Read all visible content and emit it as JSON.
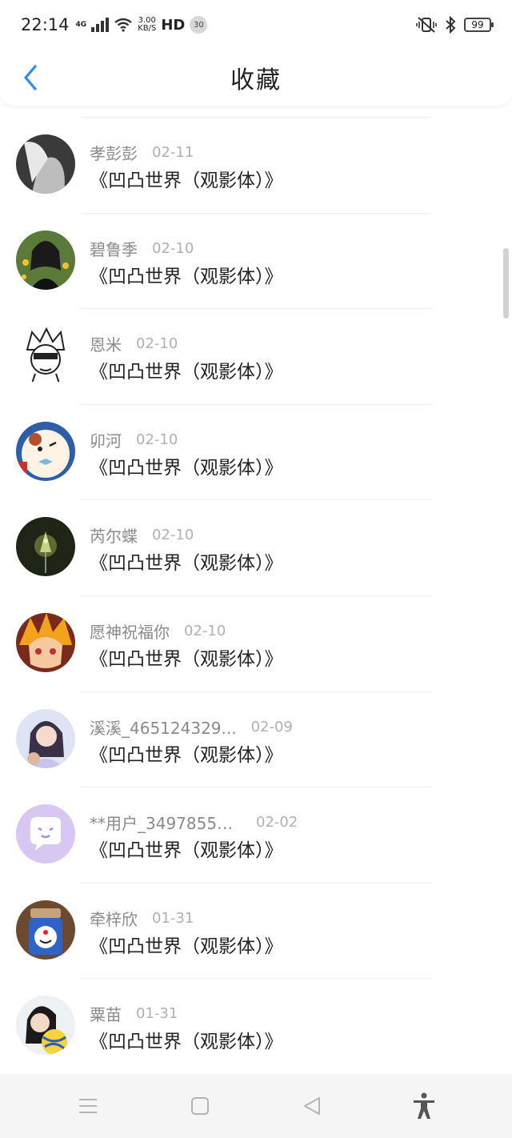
{
  "status": {
    "time": "22:14",
    "network": "4G",
    "speed_value": "3.00",
    "speed_unit": "KB/S",
    "hd": "HD",
    "badge": "30",
    "battery": "99"
  },
  "header": {
    "title": "收藏"
  },
  "items": [
    {
      "name": "孝彭彭",
      "date": "02-11",
      "title": "《凹凸世界（观影体）》"
    },
    {
      "name": "碧鲁季",
      "date": "02-10",
      "title": "《凹凸世界（观影体）》"
    },
    {
      "name": "恩米",
      "date": "02-10",
      "title": "《凹凸世界（观影体）》"
    },
    {
      "name": "卯河",
      "date": "02-10",
      "title": "《凹凸世界（观影体）》"
    },
    {
      "name": "芮尔蝶",
      "date": "02-10",
      "title": "《凹凸世界（观影体）》"
    },
    {
      "name": "愿神祝福你",
      "date": "02-10",
      "title": "《凹凸世界（观影体）》"
    },
    {
      "name": "溪溪_465124329...",
      "date": "02-09",
      "title": "《凹凸世界（观影体）》"
    },
    {
      "name": "**用户_34978551...",
      "date": "02-02",
      "title": "《凹凸世界（观影体）》"
    },
    {
      "name": "牵梓欣",
      "date": "01-31",
      "title": "《凹凸世界（观影体）》"
    },
    {
      "name": "粟苗",
      "date": "01-31",
      "title": "《凹凸世界（观影体）》"
    }
  ],
  "colors": {
    "accent": "#2d8cf0",
    "text": "#222222",
    "subtext": "#8a8a8a",
    "date": "#b0b0b0"
  },
  "icons": {
    "back": "chevron-left-icon",
    "menu": "menu-icon",
    "home": "home-square-icon",
    "back_nav": "back-triangle-icon",
    "accessibility": "accessibility-icon"
  }
}
